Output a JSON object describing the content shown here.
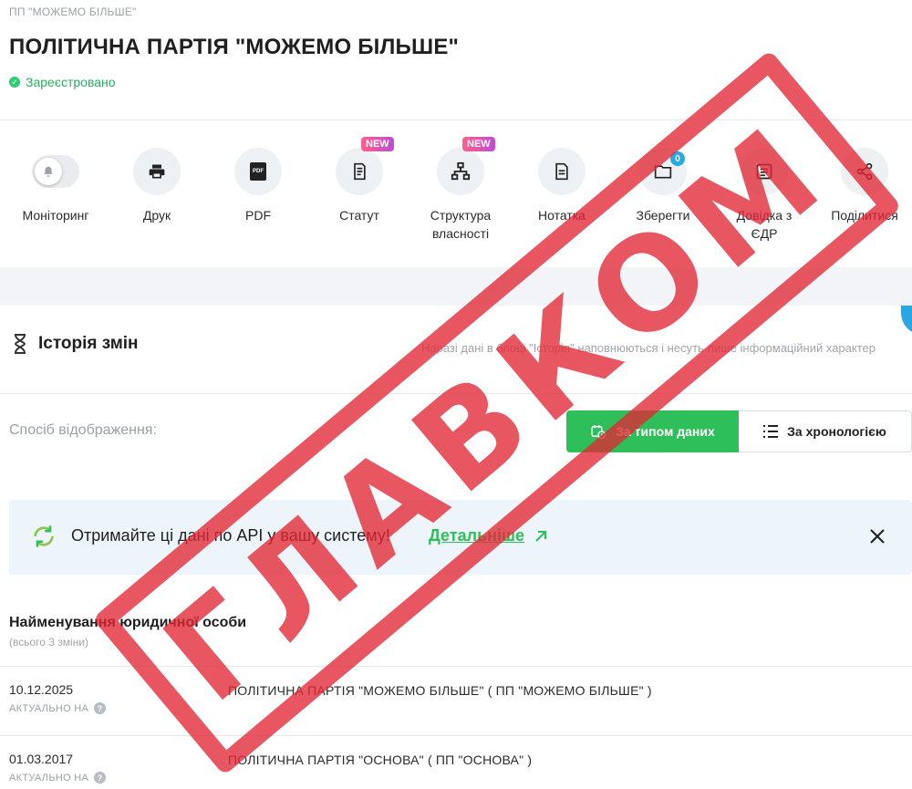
{
  "header": {
    "short_name": "ПП \"МОЖЕМО БІЛЬШЕ\"",
    "title": "ПОЛІТИЧНА ПАРТІЯ \"МОЖЕМО БІЛЬШЕ\"",
    "status": "Зареєстровано",
    "status_color": "#2ecc71"
  },
  "actions": [
    {
      "label": "Моніторинг",
      "icon": "bell-icon"
    },
    {
      "label": "Друк",
      "icon": "printer-icon"
    },
    {
      "label": "PDF",
      "icon": "pdf-icon",
      "icon_text": "PDF"
    },
    {
      "label": "Статут",
      "icon": "document-icon",
      "badge": "NEW"
    },
    {
      "label": "Структура власності",
      "icon": "org-structure-icon",
      "badge": "NEW"
    },
    {
      "label": "Нотатка",
      "icon": "note-icon"
    },
    {
      "label": "Зберегти",
      "icon": "folder-icon",
      "count": "0"
    },
    {
      "label": "Довідка з ЄДР",
      "icon": "certificate-icon"
    },
    {
      "label": "Поділитися",
      "icon": "share-icon"
    }
  ],
  "history": {
    "title": "Історія змін",
    "note": "Наразі дані в блоці \"Історія\" наповнюються і несуть лише інформаційний характер"
  },
  "display_mode": {
    "label": "Спосіб відображення:",
    "options": [
      "За типом даних",
      "За хронологією"
    ],
    "selected": "За типом даних",
    "accent": "#2fbf5a"
  },
  "api_banner": {
    "text": "Отримайте ці дані по API у вашу систему!",
    "link": "Детальніше"
  },
  "section": {
    "title": "Найменування юридичної особи",
    "subtitle": "(всього 3 зміни)",
    "rows": [
      {
        "date": "10.12.2025",
        "meta": "АКТУАЛЬНО НА",
        "value": "ПОЛІТИЧНА ПАРТІЯ \"МОЖЕМО БІЛЬШЕ\" ( ПП \"МОЖЕМО БІЛЬШЕ\" )"
      },
      {
        "date": "01.03.2017",
        "meta": "АКТУАЛЬНО НА",
        "value": "ПОЛІТИЧНА ПАРТІЯ \"ОСНОВА\" ( ПП \"ОСНОВА\" )"
      }
    ]
  },
  "watermark": {
    "text": "ГЛАВКОМ",
    "color": "#e22834"
  }
}
